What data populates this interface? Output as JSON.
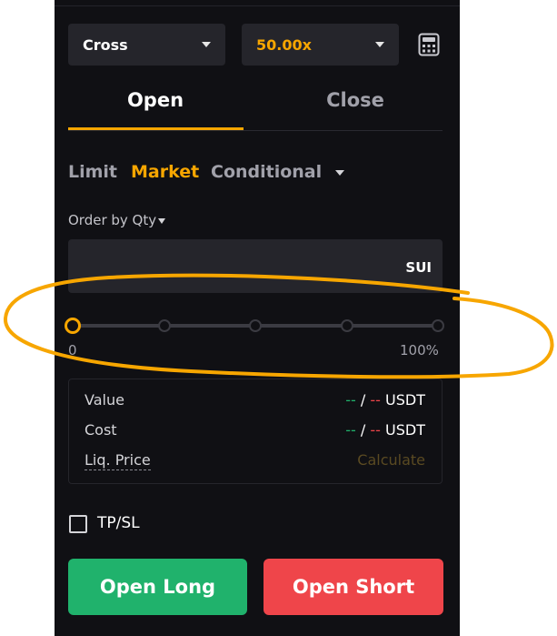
{
  "margin_select": {
    "value": "Cross"
  },
  "leverage_select": {
    "value": "50.00x"
  },
  "tabs": {
    "open": "Open",
    "close": "Close"
  },
  "order_types": {
    "limit": "Limit",
    "market": "Market",
    "conditional": "Conditional"
  },
  "order_by": {
    "label": "Order by Qty"
  },
  "qty_input": {
    "value": "",
    "unit": "SUI"
  },
  "slider": {
    "min_label": "0",
    "max_label": "100%",
    "value_fraction": 0
  },
  "info": {
    "value_label": "Value",
    "cost_label": "Cost",
    "liq_label": "Liq. Price",
    "dash": "--",
    "sep": "/",
    "currency": "USDT",
    "calculate": "Calculate"
  },
  "tpsl": {
    "label": "TP/SL",
    "checked": false
  },
  "buttons": {
    "open_long": "Open Long",
    "open_short": "Open Short"
  },
  "colors": {
    "accent": "#f7a600",
    "long": "#20b26c",
    "short": "#ef454a",
    "panel_bg": "#101014",
    "field_bg": "#25252b",
    "annotation": "#f7a600"
  }
}
